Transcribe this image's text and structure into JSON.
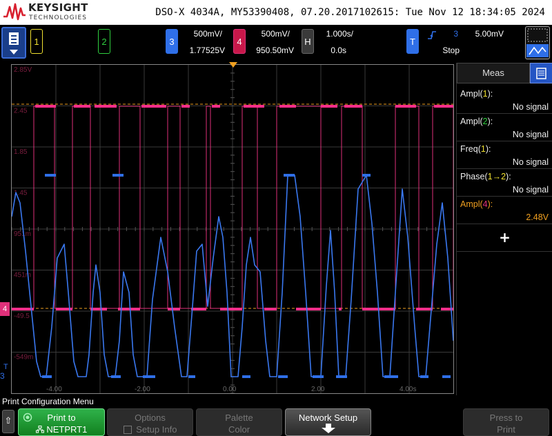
{
  "header": {
    "brand": "KEYSIGHT",
    "brand_sub": "TECHNOLOGIES",
    "scope_id": "DSO-X 4034A, MY53390408, 07.20.2017102615: Tue Nov 12 18:34:05 2024"
  },
  "channels": {
    "ch1": {
      "number": "1",
      "color": "#f0e030"
    },
    "ch2": {
      "number": "2",
      "color": "#30d040"
    },
    "ch3": {
      "number": "3",
      "color": "#2f6fe8",
      "scale": "500mV/",
      "offset": "1.77525V"
    },
    "ch4": {
      "number": "4",
      "color": "#e0307a",
      "scale": "500mV/",
      "offset": "950.50mV"
    },
    "horizontal": {
      "label": "H",
      "timebase": "1.000s/",
      "delay": "0.0s"
    },
    "trigger": {
      "label": "T",
      "source": "3",
      "level": "5.00mV",
      "state": "Stop"
    }
  },
  "grid": {
    "y_labels": [
      "2.85V",
      "2.45",
      "1.85",
      "1.45",
      "951m",
      "451m",
      "-49.5",
      "-549m"
    ],
    "x_labels": [
      "-4.00",
      "-2.00",
      "0.00",
      "2.00",
      "4.00s"
    ],
    "ch4_marker": "4",
    "ch3_marker": "3",
    "trigger_marker": "T"
  },
  "meas": {
    "title": "Meas",
    "rows": [
      {
        "name": "Ampl",
        "src": "1",
        "value": "No signal",
        "color": "#eeeeee",
        "src_color": "#f0e030"
      },
      {
        "name": "Ampl",
        "src": "2",
        "value": "No signal",
        "color": "#eeeeee",
        "src_color": "#30d040"
      },
      {
        "name": "Freq",
        "src": "1",
        "value": "No signal",
        "color": "#eeeeee",
        "src_color": "#f0e030"
      },
      {
        "name": "Phase",
        "src": "1→2",
        "value": "No signal",
        "color": "#eeeeee",
        "src_color": "#f0e030"
      },
      {
        "name": "Ampl",
        "src": "4",
        "value": "2.48V",
        "color": "#f0a020",
        "src_color": "#e0307a"
      }
    ],
    "add": "+"
  },
  "menu": {
    "title": "Print Configuration Menu",
    "back": "⇧",
    "keys": [
      {
        "label": "Print to",
        "sub": "NETPRT1"
      },
      {
        "label": "Options",
        "sub": "Setup Info"
      },
      {
        "label": "Palette",
        "sub": "Color"
      },
      {
        "label": "Network Setup",
        "sub": ""
      },
      {
        "label": "Press to",
        "sub": "Print"
      }
    ]
  }
}
